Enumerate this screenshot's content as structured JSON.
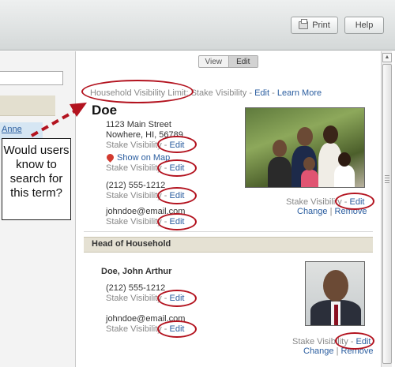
{
  "toolbar": {
    "print_label": "Print",
    "help_label": "Help"
  },
  "left": {
    "link": "Anne"
  },
  "view_toggle": {
    "view": "View",
    "edit": "Edit"
  },
  "household": {
    "visibility_limit_label": "Household Visibility Limit:",
    "visibility_limit_value": "Stake Visibility",
    "edit": "Edit",
    "learn_more": "Learn More",
    "name": "Doe",
    "address_line1": "1123 Main Street",
    "address_line2": "Nowhere, HI, 56789",
    "address_visibility": "Stake Visibility",
    "show_on_map": "Show on Map",
    "map_visibility": "Stake Visibility",
    "phone": "(212) 555-1212",
    "phone_visibility": "Stake Visibility",
    "email": "johndoe@email.com",
    "email_visibility": "Stake Visibility",
    "photo_visibility": "Stake Visibility",
    "photo_change": "Change",
    "photo_remove": "Remove",
    "sep": " - ",
    "pipe": " | "
  },
  "head_of_household": {
    "section_title": "Head of Household",
    "name": "Doe, John Arthur",
    "phone": "(212) 555-1212",
    "phone_visibility": "Stake Visibility",
    "email": "johndoe@email.com",
    "email_visibility": "Stake Visibility",
    "photo_visibility": "Stake Visibility",
    "photo_change": "Change",
    "photo_remove": "Remove"
  },
  "annotation": {
    "callout_text": "Would users know to search for this term?",
    "color": "#b3131f"
  }
}
